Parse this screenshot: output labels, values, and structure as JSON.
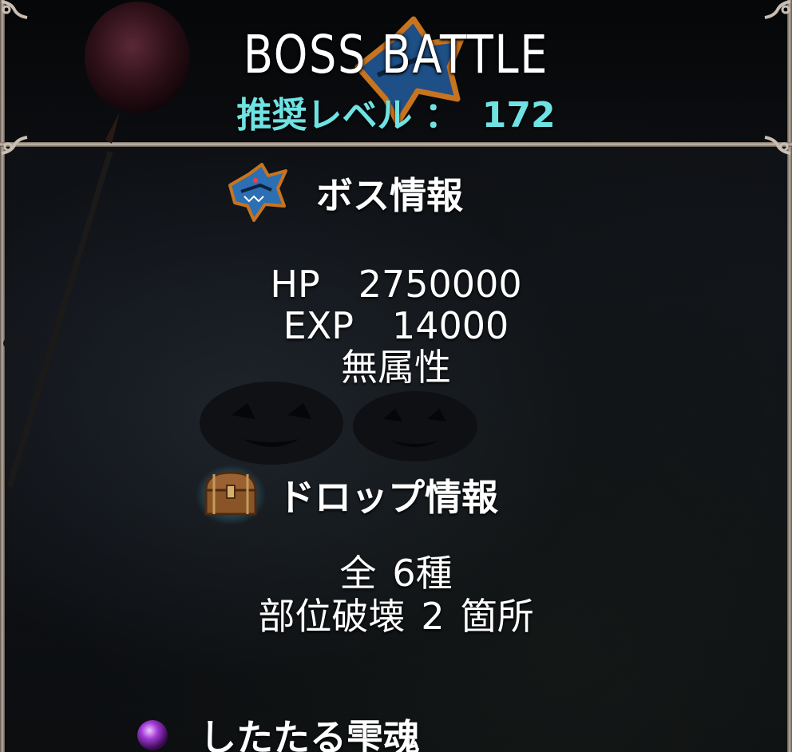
{
  "header": {
    "title": "BOSS BATTLE",
    "level_label": "推奨レベル ：",
    "level_value": "172"
  },
  "boss_info": {
    "heading": "ボス情報",
    "icon": "shark-boss-icon",
    "hp_label": "HP",
    "hp_value": "2750000",
    "exp_label": "EXP",
    "exp_value": "14000",
    "attribute": "無属性"
  },
  "drop_info": {
    "heading": "ドロップ情報",
    "icon": "treasure-chest-icon",
    "total_label": "全",
    "total_value": "6種",
    "part_break_label": "部位破壊",
    "part_break_count": "2",
    "part_break_unit": "箇所"
  },
  "material": {
    "icon": "purple-orb-icon",
    "name": "したたる雫魂"
  },
  "colors": {
    "title": "#ffffff",
    "level": "#6fe3e3",
    "frame": "#c9beb2"
  }
}
